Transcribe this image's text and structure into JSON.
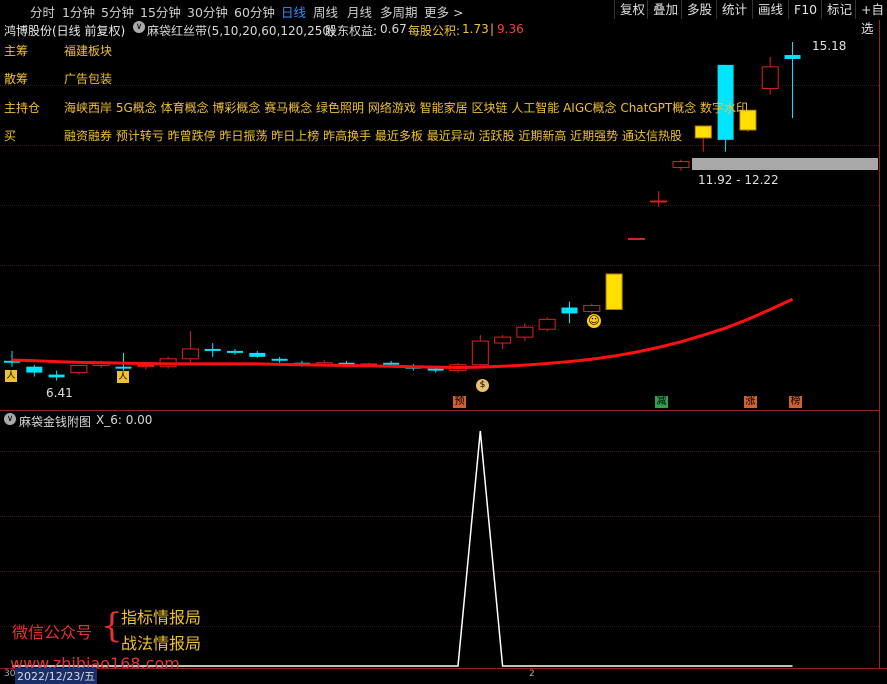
{
  "tabs": [
    "分时",
    "1分钟",
    "5分钟",
    "15分钟",
    "30分钟",
    "60分钟",
    "日线",
    "周线",
    "月线",
    "多周期",
    "更多 >"
  ],
  "active_tab": "日线",
  "right_buttons": [
    "复权",
    "叠加",
    "多股",
    "统计",
    "画线",
    "F10",
    "标记",
    "+自选"
  ],
  "stock_title": "鸿博股份(日线 前复权)",
  "indicator_name": "麻袋红丝带(5,10,20,60,120,250)",
  "equity_label": "股东权益:",
  "equity_value": "0.67",
  "reserve_label": "每股公积:",
  "reserve_value": "1.73",
  "reserve_extra": "9.36",
  "tags": [
    {
      "key": "主筹",
      "value": "福建板块"
    },
    {
      "key": "散筹",
      "value": "广告包装"
    },
    {
      "key": "主持仓",
      "value": "海峡西岸 5G概念 体育概念 博彩概念 赛马概念 绿色照明 网络游戏 智能家居 区块链 人工智能 AIGC概念 ChatGPT概念 数字水印"
    },
    {
      "key": "买",
      "value": "融资融券 预计转亏 昨曾跌停 昨日振荡 昨日上榜 昨高换手 最近多板 最近异动 活跃股 近期新高 近期强势 通达信热股"
    }
  ],
  "price_high_label": "15.18",
  "price_low_label": "6.41",
  "range_label": "11.92 - 12.22",
  "markers": [
    {
      "text": "预",
      "color": "#e05020"
    },
    {
      "text": "减",
      "color": "#20a040"
    },
    {
      "text": "涨",
      "color": "#e05020"
    },
    {
      "text": "榜",
      "color": "#e05020"
    }
  ],
  "sub_indicator_name": "麻袋金钱附图",
  "sub_indicator_value": "X_6: 0.00",
  "watermark_prefix": "微信公众号",
  "watermark_line1": "指标情报局",
  "watermark_line2": "战法情报局",
  "watermark_url": "www.zhibiao168.com",
  "date_label": "2022/12/23/五",
  "bottom_tick_left": "30",
  "bottom_tick_mid": "2",
  "colors": {
    "up": "#e02020",
    "down": "#00e5ff",
    "yellow": "#ffe000",
    "ma": "#ff1010",
    "grid": "#3a1818"
  },
  "chart_data": {
    "type": "candlestick",
    "y_range_main": [
      6.41,
      15.18
    ],
    "candles": [
      {
        "o": 7.05,
        "h": 7.35,
        "l": 6.95,
        "c": 7.1,
        "up": false
      },
      {
        "o": 6.95,
        "h": 7.0,
        "l": 6.7,
        "c": 6.8,
        "up": false
      },
      {
        "o": 6.75,
        "h": 6.85,
        "l": 6.6,
        "c": 6.68,
        "up": false
      },
      {
        "o": 6.8,
        "h": 7.0,
        "l": 6.75,
        "c": 6.98,
        "up": true
      },
      {
        "o": 6.98,
        "h": 7.1,
        "l": 6.92,
        "c": 7.05,
        "up": true
      },
      {
        "o": 6.95,
        "h": 7.3,
        "l": 6.85,
        "c": 6.9,
        "up": false
      },
      {
        "o": 6.95,
        "h": 7.0,
        "l": 6.88,
        "c": 6.98,
        "up": true
      },
      {
        "o": 6.95,
        "h": 7.2,
        "l": 6.9,
        "c": 7.15,
        "up": true
      },
      {
        "o": 7.15,
        "h": 7.85,
        "l": 7.05,
        "c": 7.4,
        "up": true
      },
      {
        "o": 7.4,
        "h": 7.55,
        "l": 7.2,
        "c": 7.35,
        "up": false
      },
      {
        "o": 7.35,
        "h": 7.4,
        "l": 7.25,
        "c": 7.3,
        "up": false
      },
      {
        "o": 7.3,
        "h": 7.35,
        "l": 7.18,
        "c": 7.2,
        "up": false
      },
      {
        "o": 7.15,
        "h": 7.2,
        "l": 7.05,
        "c": 7.1,
        "up": false
      },
      {
        "o": 7.05,
        "h": 7.1,
        "l": 6.95,
        "c": 7.0,
        "up": false
      },
      {
        "o": 7.0,
        "h": 7.12,
        "l": 6.95,
        "c": 7.05,
        "up": true
      },
      {
        "o": 7.05,
        "h": 7.1,
        "l": 6.95,
        "c": 7.0,
        "up": false
      },
      {
        "o": 7.0,
        "h": 7.05,
        "l": 6.95,
        "c": 7.02,
        "up": true
      },
      {
        "o": 7.05,
        "h": 7.1,
        "l": 6.98,
        "c": 7.0,
        "up": false
      },
      {
        "o": 6.98,
        "h": 7.02,
        "l": 6.85,
        "c": 6.9,
        "up": false
      },
      {
        "o": 6.9,
        "h": 6.95,
        "l": 6.8,
        "c": 6.85,
        "up": false
      },
      {
        "o": 6.85,
        "h": 7.05,
        "l": 6.8,
        "c": 7.0,
        "up": true
      },
      {
        "o": 7.0,
        "h": 7.75,
        "l": 6.95,
        "c": 7.6,
        "up": true
      },
      {
        "o": 7.55,
        "h": 7.75,
        "l": 7.4,
        "c": 7.7,
        "up": true
      },
      {
        "o": 7.7,
        "h": 8.05,
        "l": 7.6,
        "c": 7.95,
        "up": true
      },
      {
        "o": 7.9,
        "h": 8.2,
        "l": 7.85,
        "c": 8.15,
        "up": true
      },
      {
        "o": 8.45,
        "h": 8.6,
        "l": 8.05,
        "c": 8.3,
        "up": false
      },
      {
        "o": 8.35,
        "h": 8.55,
        "l": 8.3,
        "c": 8.5,
        "up": true
      },
      {
        "o": 8.4,
        "h": 9.3,
        "l": 8.4,
        "c": 9.3,
        "up": true,
        "limit": true
      },
      {
        "o": 10.2,
        "h": 10.2,
        "l": 10.2,
        "c": 10.2,
        "up": true
      },
      {
        "o": 11.15,
        "h": 11.4,
        "l": 11.0,
        "c": 11.15,
        "up": true
      },
      {
        "o": 12.0,
        "h": 12.2,
        "l": 11.92,
        "c": 12.15,
        "up": true
      },
      {
        "o": 12.75,
        "h": 12.9,
        "l": 12.4,
        "c": 13.05,
        "up": true,
        "limit": true
      },
      {
        "o": 14.6,
        "h": 14.6,
        "l": 12.4,
        "c": 12.7,
        "up": false
      },
      {
        "o": 12.95,
        "h": 13.25,
        "l": 12.9,
        "c": 13.45,
        "up": true,
        "limit": true
      },
      {
        "o": 14.0,
        "h": 14.8,
        "l": 13.85,
        "c": 14.55,
        "up": true
      },
      {
        "o": 14.85,
        "h": 15.18,
        "l": 13.25,
        "c": 14.75,
        "up": false
      }
    ],
    "ma_line": [
      7.12,
      7.1,
      7.08,
      7.06,
      7.05,
      7.04,
      7.03,
      7.02,
      7.02,
      7.02,
      7.02,
      7.02,
      7.01,
      7.0,
      6.99,
      6.98,
      6.97,
      6.96,
      6.95,
      6.94,
      6.93,
      6.94,
      6.96,
      6.99,
      7.03,
      7.08,
      7.14,
      7.22,
      7.32,
      7.44,
      7.58,
      7.75,
      7.93,
      8.15,
      8.4,
      8.66
    ],
    "sub_values": [
      0,
      0,
      0,
      0,
      0,
      0,
      0,
      0,
      0,
      0,
      0,
      0,
      0,
      0,
      0,
      0,
      0,
      0,
      0,
      0,
      0,
      1,
      0,
      0,
      0,
      0,
      0,
      0,
      0,
      0,
      0,
      0,
      0,
      0,
      0,
      0
    ],
    "sub_range": [
      0,
      1
    ]
  }
}
